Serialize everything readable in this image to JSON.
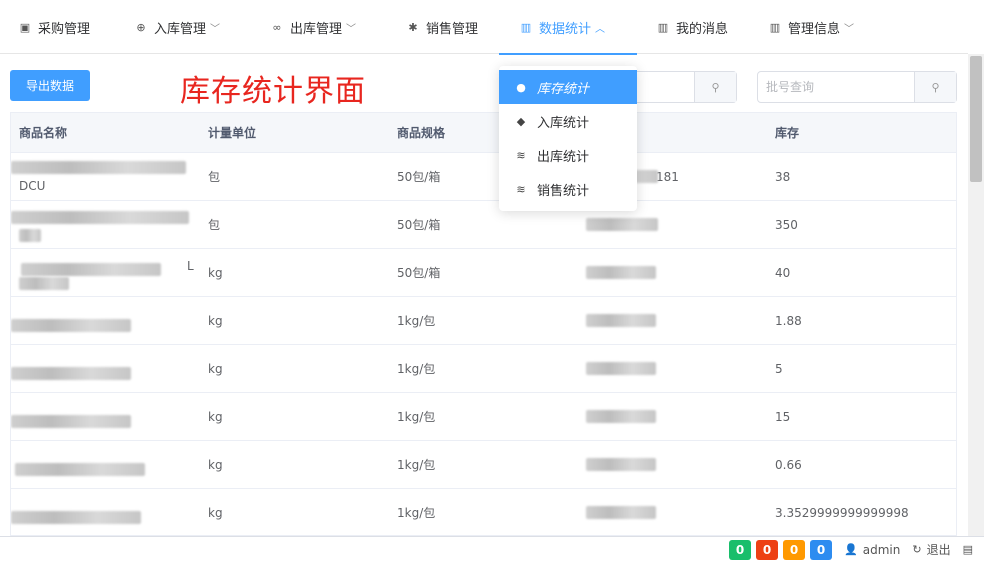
{
  "nav": [
    {
      "label": "采购管理",
      "icon": "bag-icon",
      "glyph": "▣",
      "chevron": false,
      "active": false
    },
    {
      "label": "入库管理",
      "icon": "lifebuoy-icon",
      "glyph": "⊕",
      "chevron": true,
      "active": false
    },
    {
      "label": "出库管理",
      "icon": "link-icon",
      "glyph": "∞",
      "chevron": true,
      "active": false
    },
    {
      "label": "销售管理",
      "icon": "gear-icon",
      "glyph": "✱",
      "chevron": false,
      "active": false
    },
    {
      "label": "数据统计",
      "icon": "bar-chart-icon",
      "glyph": "▥",
      "chevron": true,
      "active": true
    },
    {
      "label": "我的消息",
      "icon": "bar-chart-icon",
      "glyph": "▥",
      "chevron": false,
      "active": false
    },
    {
      "label": "管理信息",
      "icon": "bar-chart-icon",
      "glyph": "▥",
      "chevron": true,
      "active": false
    }
  ],
  "chevron_down": "﹀",
  "chevron_up": "︿",
  "toolbar": {
    "export_label": "导出数据",
    "overlay_title": "库存统计界面",
    "batch_placeholder": "批号查询"
  },
  "dropdown": [
    {
      "label": "库存统计",
      "icon": "chat-bubble-icon",
      "glyph": "●",
      "active": true
    },
    {
      "label": "入库统计",
      "icon": "tag-icon",
      "glyph": "◆",
      "active": false
    },
    {
      "label": "出库统计",
      "icon": "wifi-icon",
      "glyph": "≋",
      "active": false
    },
    {
      "label": "销售统计",
      "icon": "wifi-icon",
      "glyph": "≋",
      "active": false
    }
  ],
  "table": {
    "columns": [
      "商品名称",
      "计量单位",
      "商品规格",
      "",
      "库存"
    ],
    "rows": [
      {
        "name_tail": "DCU",
        "unit": "包",
        "spec": "50包/箱",
        "batch_tail": "181",
        "stock": "38"
      },
      {
        "name_tail": "",
        "unit": "包",
        "spec": "50包/箱",
        "batch_tail": "",
        "stock": "350"
      },
      {
        "name_tail": "L",
        "unit": "kg",
        "spec": "50包/箱",
        "batch_tail": "",
        "stock": "40"
      },
      {
        "name_tail": "",
        "unit": "kg",
        "spec": "1kg/包",
        "batch_tail": "",
        "stock": "1.88"
      },
      {
        "name_tail": "",
        "unit": "kg",
        "spec": "1kg/包",
        "batch_tail": "",
        "stock": "5"
      },
      {
        "name_tail": "",
        "unit": "kg",
        "spec": "1kg/包",
        "batch_tail": "",
        "stock": "15"
      },
      {
        "name_tail": "",
        "unit": "kg",
        "spec": "1kg/包",
        "batch_tail": "",
        "stock": "0.66"
      },
      {
        "name_tail": "",
        "unit": "kg",
        "spec": "1kg/包",
        "batch_tail": "",
        "stock": "3.3529999999999998"
      }
    ]
  },
  "footer": {
    "badges": [
      {
        "value": "0",
        "color": "#19be6b"
      },
      {
        "value": "0",
        "color": "#ed4014"
      },
      {
        "value": "0",
        "color": "#ff9900"
      },
      {
        "value": "0",
        "color": "#2d8cf0"
      }
    ],
    "user": "admin",
    "logout": "退出",
    "user_glyph": "👤",
    "logout_glyph": "↻",
    "extra_glyph": "▤"
  }
}
